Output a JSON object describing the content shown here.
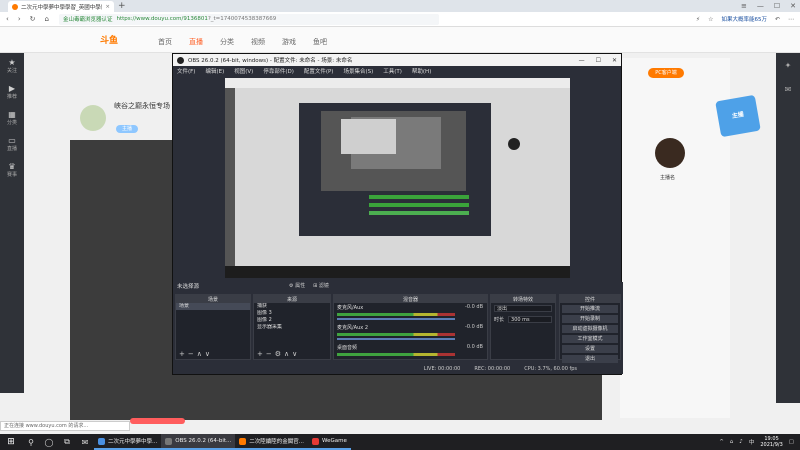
{
  "browser": {
    "tab_title": "二次元中學夢中學學習_英國中學留學",
    "url_secure": "金山毒霸浏览器认证",
    "url": "https://www.douyu.com/9136801",
    "url_params": "?_t=1740074538387669",
    "hot_search": "如果大概率能65万",
    "new_tab_symbol": "+",
    "status_text": "正在连接 www.douyu.com 的请求..."
  },
  "site": {
    "logo": "斗鱼",
    "nav": [
      "首页",
      "直播",
      "分类",
      "视频",
      "游戏",
      "鱼吧"
    ],
    "active_nav": "直播",
    "stream_title": "峡谷之巅永恒专场",
    "tag": "主播",
    "right_chip": "PC客户端",
    "right_badge": "主播",
    "streamer_name": "主播名",
    "sidebar": [
      {
        "icon": "star",
        "label": "关注"
      },
      {
        "icon": "play",
        "label": "推荐"
      },
      {
        "icon": "grid",
        "label": "分类"
      },
      {
        "icon": "tv",
        "label": "直播"
      },
      {
        "icon": "trophy",
        "label": "赛事"
      }
    ]
  },
  "obs": {
    "title": "OBS 26.0.2 (64-bit, windows) - 配置文件: 未命名 - 场景: 未命名",
    "menu": [
      "文件(F)",
      "编辑(E)",
      "视图(V)",
      "停靠部件(D)",
      "配置文件(P)",
      "场景集合(S)",
      "工具(T)",
      "帮助(H)"
    ],
    "no_source_label": "未选择源",
    "props_btn": "属性",
    "filters_btn": "滤镜",
    "docks": {
      "scenes": {
        "header": "场景",
        "items": [
          "场景"
        ]
      },
      "sources": {
        "header": "来源",
        "items": [
          "捕获",
          "图像 3",
          "图像 2",
          "显示器采集"
        ]
      },
      "mixer": {
        "header": "混音器",
        "tracks": [
          {
            "name": "麦克风/Aux",
            "db": "-0.0 dB"
          },
          {
            "name": "麦克风/Aux 2",
            "db": "-0.0 dB"
          },
          {
            "name": "桌面音频",
            "db": "0.0 dB"
          }
        ]
      },
      "transitions": {
        "header": "转场特效",
        "type": "淡出",
        "duration_label": "时长",
        "duration": "300 ms"
      },
      "controls": {
        "header": "控件",
        "buttons": [
          "开始推流",
          "开始录制",
          "启动虚拟摄像机",
          "工作室模式",
          "设置",
          "退出"
        ]
      }
    },
    "status": {
      "live": "LIVE: 00:00:00",
      "rec": "REC: 00:00:00",
      "cpu": "CPU: 3.7%, 60.00 fps"
    }
  },
  "taskbar": {
    "start_icon": "windows",
    "apps": [
      {
        "label": "二次元中學夢中學...",
        "color": "#ffffff",
        "active": false
      },
      {
        "label": "OBS 26.0.2 (64-bit...",
        "color": "#333333",
        "active": true
      },
      {
        "label": "二次陸續陸的金閣官...",
        "color": "#ff7a00",
        "active": false
      },
      {
        "label": "WeGame",
        "color": "#e53935",
        "active": false
      }
    ],
    "time": "19:05",
    "date": "2021/9/3"
  }
}
